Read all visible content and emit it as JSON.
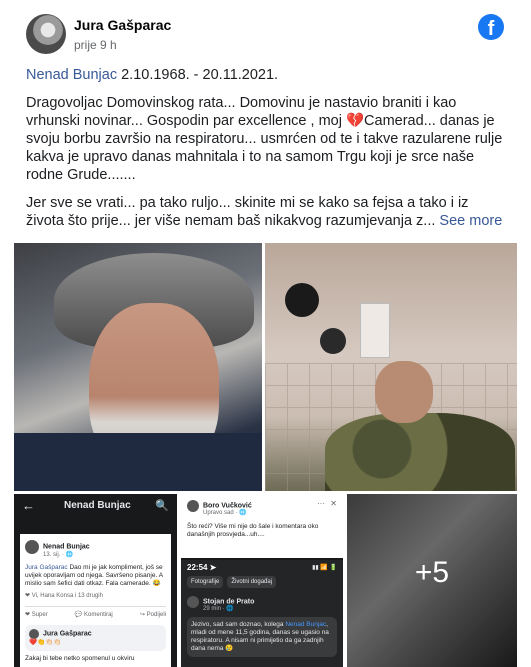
{
  "post": {
    "author": "Jura Gašparac",
    "time": "prije 9 h",
    "tagged_name": "Nenad Bunjac",
    "dates": " 2.10.1968. - 20.11.2021.",
    "paragraph1_before_heart": "Dragovoljac Domovinskog rata... Domovinu je nastavio braniti i kao vrhunski novinar... Gospodin par excellence , moj ",
    "heart": "💔",
    "paragraph1_after_heart": "Camerad... danas je svoju borbu završio na respiratoru... usmrćen od te i takve razularene rulje kakva je upravo danas mahnitala i to na samom Trgu koji je srce naše rodne Grude.......",
    "paragraph2": "Jer sve se vrati... pa tako ruljo... skinite mi se kako sa fejsa a tako i iz života što prije... jer više nemam baš nikakvog razumjevanja z... ",
    "see_more": "See more",
    "more_photos": "+5"
  },
  "icons": {
    "facebook_logo": "f"
  },
  "screenshot1": {
    "back": "←",
    "title": "Nenad Bunjac",
    "search": "🔍",
    "poster": "Nenad Bunjac",
    "poster_meta": "13. sij. · 🌐",
    "mention": "Jura Gašparac",
    "text": " Dao mi je jak kompliment, još se uvijek oporavljam od njega. Savršeno pisanje. A mislio sam šefici dati otkaz. Fala camerade. 😂",
    "reactions": "❤ Vi, Hana Konsa i 13 drugih",
    "actions": [
      "❤ Super",
      "💬 Komentiraj",
      "↪ Podijeli"
    ],
    "commenter": "Jura Gašparac",
    "comment_emoji": "❤️👏👏🏻👏🏻",
    "comment_text": "Zakaj bi tebe netko spomenul u okviru"
  },
  "screenshot2": {
    "author": "Boro Vučković",
    "meta": "Upravo sad · 🌐",
    "dots": "···",
    "close": "✕",
    "text": "Što reći? Više mi nije do šale i komentara oko današnjih prosvjeda...uh....",
    "clock": "22:54 ➤",
    "status_icons": "▮▮ 📶 🔋",
    "btn1": "Fotografije",
    "btn2": "Životni događaj",
    "commenter": "Stojan de Prato",
    "commenter_meta": "29 min · 🌐",
    "comment_before": "Jezivo, sad sam doznao, kolega ",
    "comment_link": "Nenad Bunjac",
    "comment_after": ", mladi od mene 11,5 godina, danas se ugasio na respiratoru. A nisam ni primijetio da ga zadnjih dana nema 😢"
  }
}
